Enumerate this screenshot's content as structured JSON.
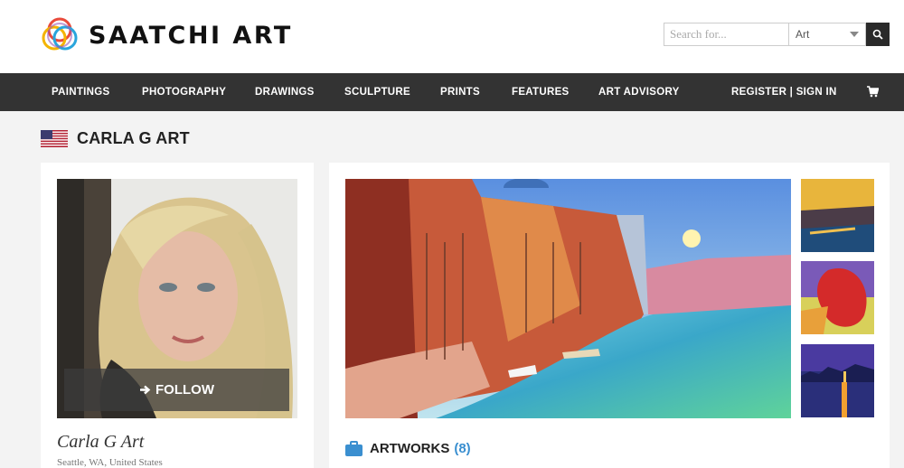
{
  "brand": {
    "name": "SAATCHI ART"
  },
  "search": {
    "placeholder": "Search for...",
    "category": "Art"
  },
  "nav": {
    "items": [
      "PAINTINGS",
      "PHOTOGRAPHY",
      "DRAWINGS",
      "SCULPTURE",
      "PRINTS",
      "FEATURES",
      "ART ADVISORY"
    ],
    "account": "REGISTER | SIGN IN"
  },
  "artist": {
    "title": "CARLA G ART",
    "display_name": "Carla G Art",
    "location": "Seattle, WA, United States",
    "follow_label": "FOLLOW"
  },
  "artworks": {
    "label": "ARTWORKS",
    "count": "(8)"
  },
  "colors": {
    "nav_bg": "#333333",
    "accent": "#3a8fd0",
    "page_bg": "#f3f3f3"
  }
}
